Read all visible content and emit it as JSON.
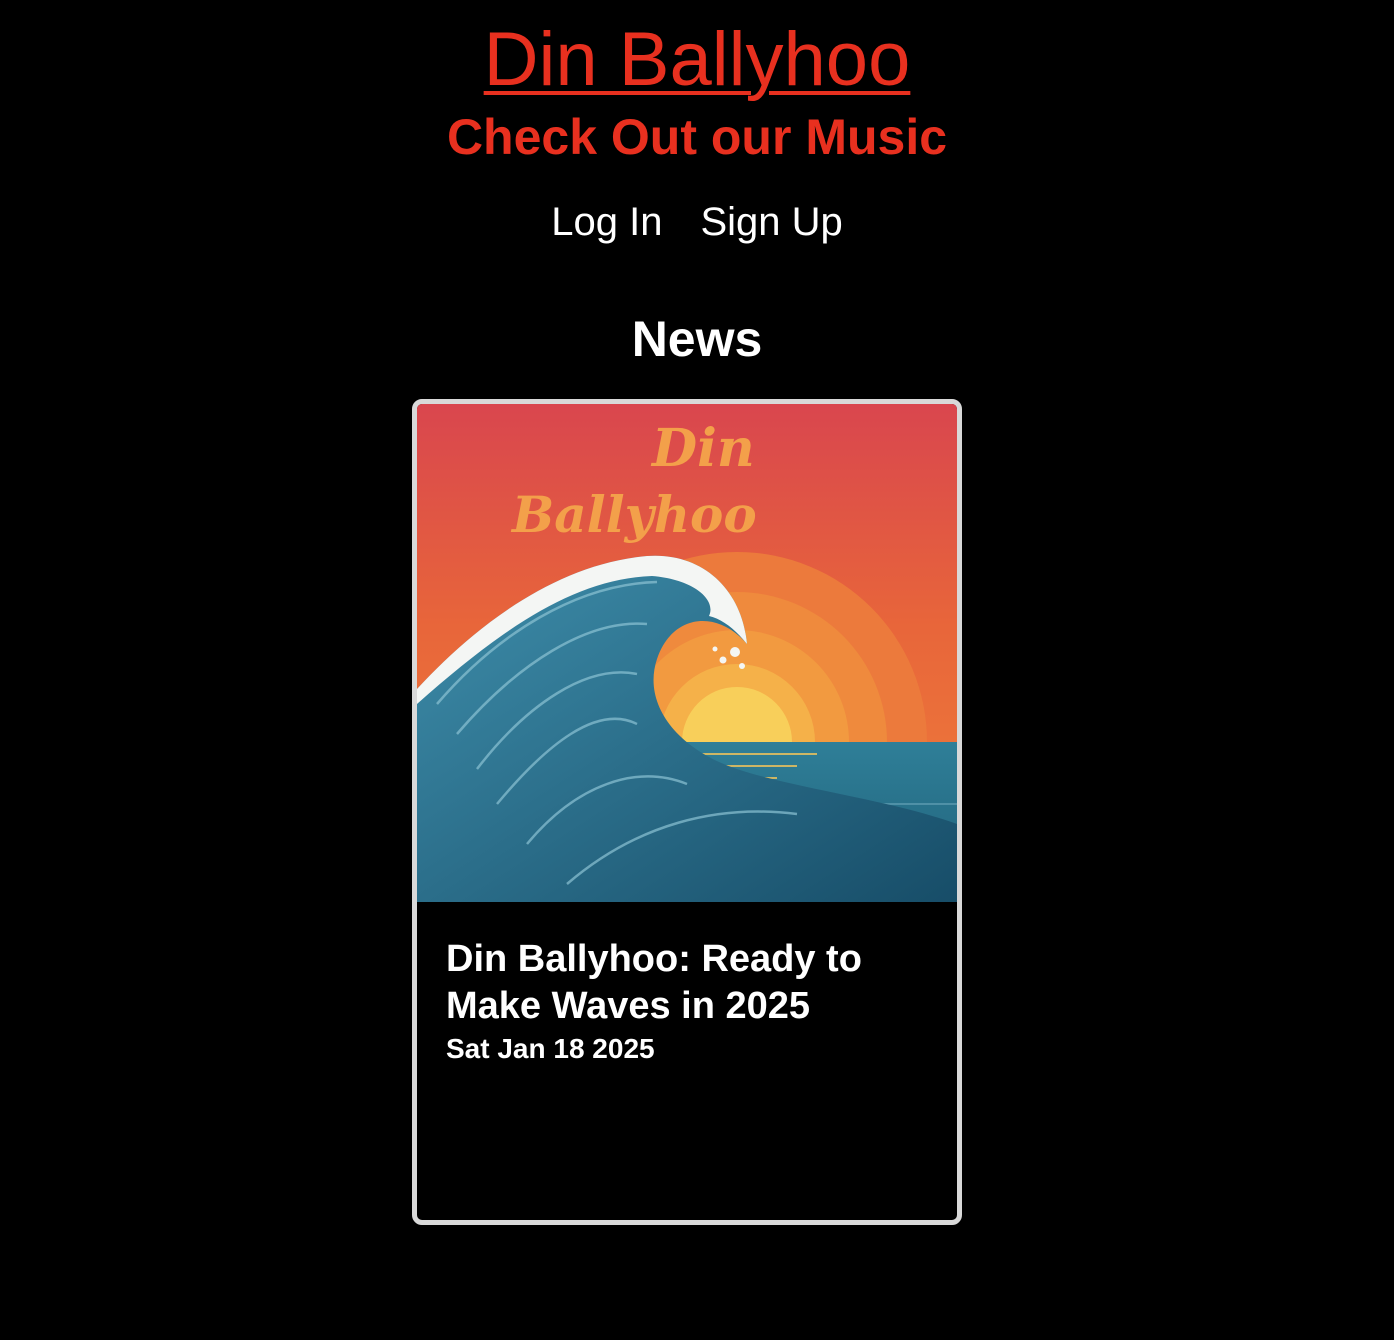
{
  "header": {
    "title": "Din Ballyhoo",
    "tagline": "Check Out our Music"
  },
  "nav": {
    "login_label": "Log In",
    "signup_label": "Sign Up"
  },
  "news": {
    "section_title": "News",
    "items": [
      {
        "title": "Din Ballyhoo: Ready to Make Waves in 2025",
        "date": "Sat Jan 18 2025",
        "image": {
          "logo_line1": "Din",
          "logo_line2": "Ballyhoo"
        }
      }
    ]
  },
  "colors": {
    "background": "#000000",
    "accent_red": "#e8301f",
    "text": "#ffffff",
    "card_border": "#d9d9d9"
  }
}
